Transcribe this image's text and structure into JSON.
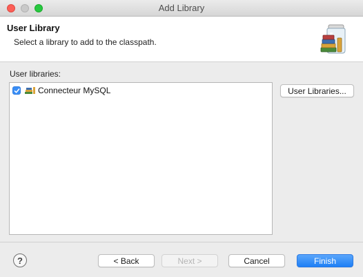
{
  "window": {
    "title": "Add Library"
  },
  "banner": {
    "title": "User Library",
    "subtitle": "Select a library to add to the classpath.",
    "icon": "library-jar-books-icon"
  },
  "list": {
    "label": "User libraries:",
    "items": [
      {
        "label": "Connecteur MySQL",
        "checked": true,
        "icon": "library-icon"
      }
    ]
  },
  "buttons": {
    "user_libraries": "User Libraries...",
    "back": "< Back",
    "next": "Next >",
    "cancel": "Cancel",
    "finish": "Finish",
    "help": "?"
  },
  "colors": {
    "accent": "#1e7ff5",
    "close": "#fc5f57",
    "minimize": "#c9c9c9",
    "maximize": "#27c840",
    "checkbox": "#3a8ef6"
  }
}
